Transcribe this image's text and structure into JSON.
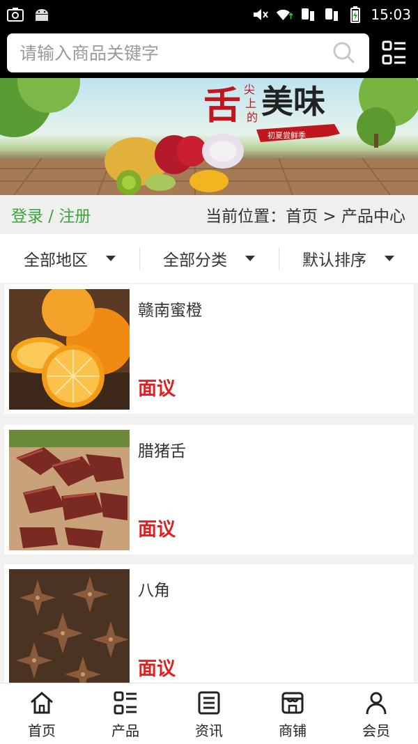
{
  "status_bar": {
    "time": "15:03",
    "left_icons": [
      "screenshot-icon",
      "android-icon"
    ],
    "right_icons": [
      "mute-icon",
      "wifi-icon",
      "sim1-signal-icon",
      "sim2-signal-icon",
      "battery-charging-icon"
    ]
  },
  "search": {
    "placeholder": "请输入商品关键字"
  },
  "banner": {
    "title_big_1": "舌",
    "title_small_1": "尖",
    "title_small_2": "上",
    "title_small_3": "的",
    "title_big_2": "美味",
    "ribbon": "初夏尝鲜季"
  },
  "location_bar": {
    "login": "登录 / 注册",
    "location": "当前位置：首页 > 产品中心"
  },
  "filters": [
    {
      "label": "全部地区"
    },
    {
      "label": "全部分类"
    },
    {
      "label": "默认排序"
    }
  ],
  "products": [
    {
      "name": "赣南蜜橙",
      "price": "面议"
    },
    {
      "name": "腊猪舌",
      "price": "面议"
    },
    {
      "name": "八角",
      "price": "面议"
    }
  ],
  "bottom_nav": [
    {
      "label": "首页",
      "icon": "home-icon"
    },
    {
      "label": "产品",
      "icon": "product-grid-icon"
    },
    {
      "label": "资讯",
      "icon": "news-icon"
    },
    {
      "label": "商铺",
      "icon": "shop-icon"
    },
    {
      "label": "会员",
      "icon": "member-icon"
    }
  ],
  "colors": {
    "accent_green": "#3aa63a",
    "price_red": "#e02020",
    "topbar": "#000000"
  }
}
